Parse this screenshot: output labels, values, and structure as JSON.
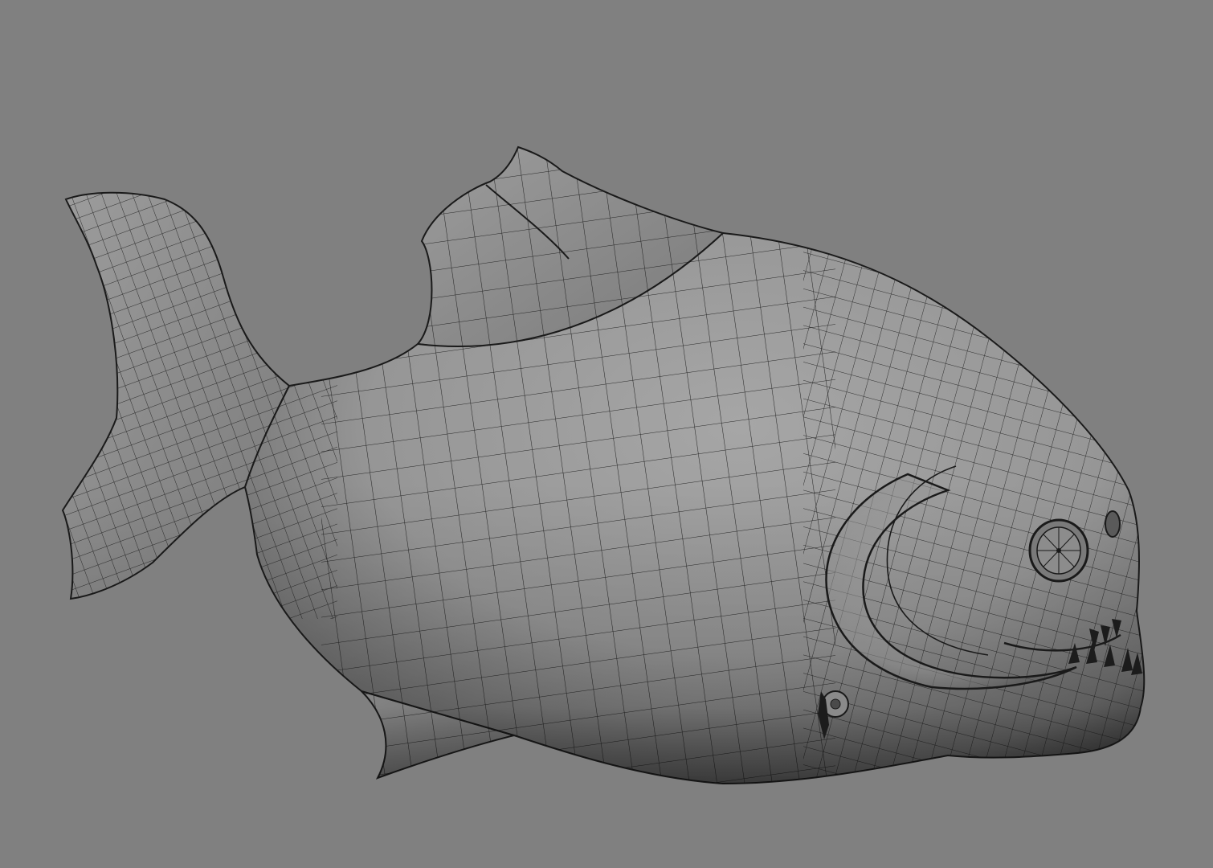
{
  "viewport": {
    "background_color": "#808080",
    "shading": "smooth-shaded-with-wireframe"
  },
  "model": {
    "subject": "piranha",
    "body_color": "#9a9a9a",
    "wire_color": "#1a1a1a",
    "shadow_color": "#4a4a4a"
  }
}
